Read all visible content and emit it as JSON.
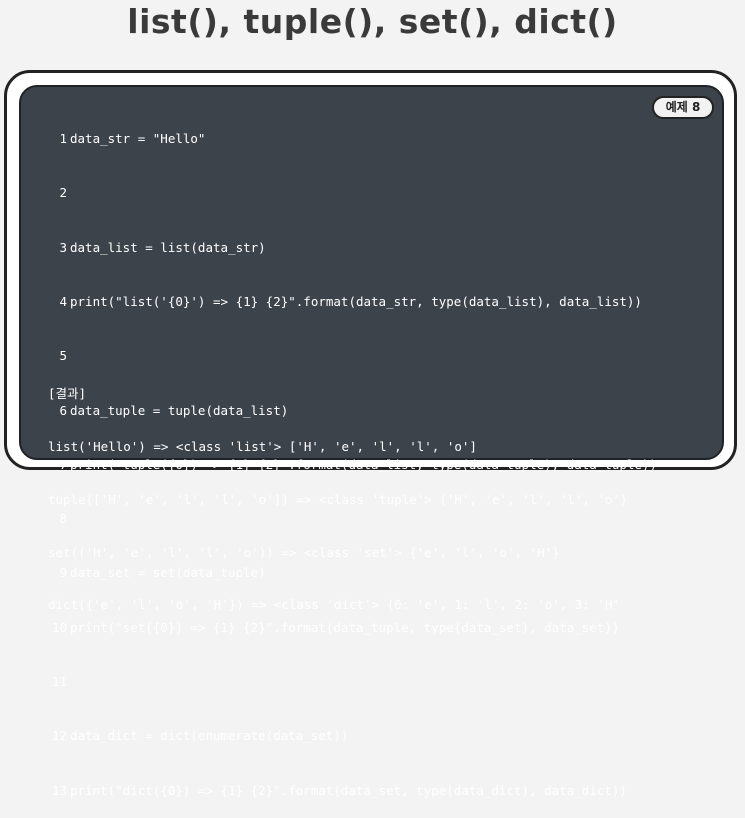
{
  "title": "list(), tuple(), set(), dict()",
  "badge": "예제 8",
  "code_lines": [
    {
      "n": "1",
      "text": "data_str = \"Hello\""
    },
    {
      "n": "2",
      "text": ""
    },
    {
      "n": "3",
      "text": "data_list = list(data_str)"
    },
    {
      "n": "4",
      "text": "print(\"list('{0}') => {1} {2}\".format(data_str, type(data_list), data_list))"
    },
    {
      "n": "5",
      "text": ""
    },
    {
      "n": "6",
      "text": "data_tuple = tuple(data_list)"
    },
    {
      "n": "7",
      "text": "print(\"tuple({0}) => {1} {2}\".format(data_list, type(data_tuple), data_tuple))"
    },
    {
      "n": "8",
      "text": ""
    },
    {
      "n": "9",
      "text": "data_set = set(data_tuple)"
    },
    {
      "n": "10",
      "text": "print(\"set({0}) => {1} {2}\".format(data_tuple, type(data_set), data_set))"
    },
    {
      "n": "11",
      "text": ""
    },
    {
      "n": "12",
      "text": "data_dict = dict(enumerate(data_set))"
    },
    {
      "n": "13",
      "text": "print(\"dict({0}) => {1} {2}\".format(data_set, type(data_dict), data_dict))"
    }
  ],
  "result_header": "[결과]",
  "result_lines": [
    "list('Hello') => <class 'list'> ['H', 'e', 'l', 'l', 'o']",
    "tuple(['H', 'e', 'l', 'l', 'o']) => <class 'tuple'> ('H', 'e', 'l', 'l', 'o')",
    "set(('H', 'e', 'l', 'l', 'o')) => <class 'set'> {'e', 'l', 'o', 'H'}",
    "dict({'e', 'l', 'o', 'H'}) => <class 'dict'> {0: 'e', 1: 'l', 2: 'o', 3: 'H'"
  ]
}
